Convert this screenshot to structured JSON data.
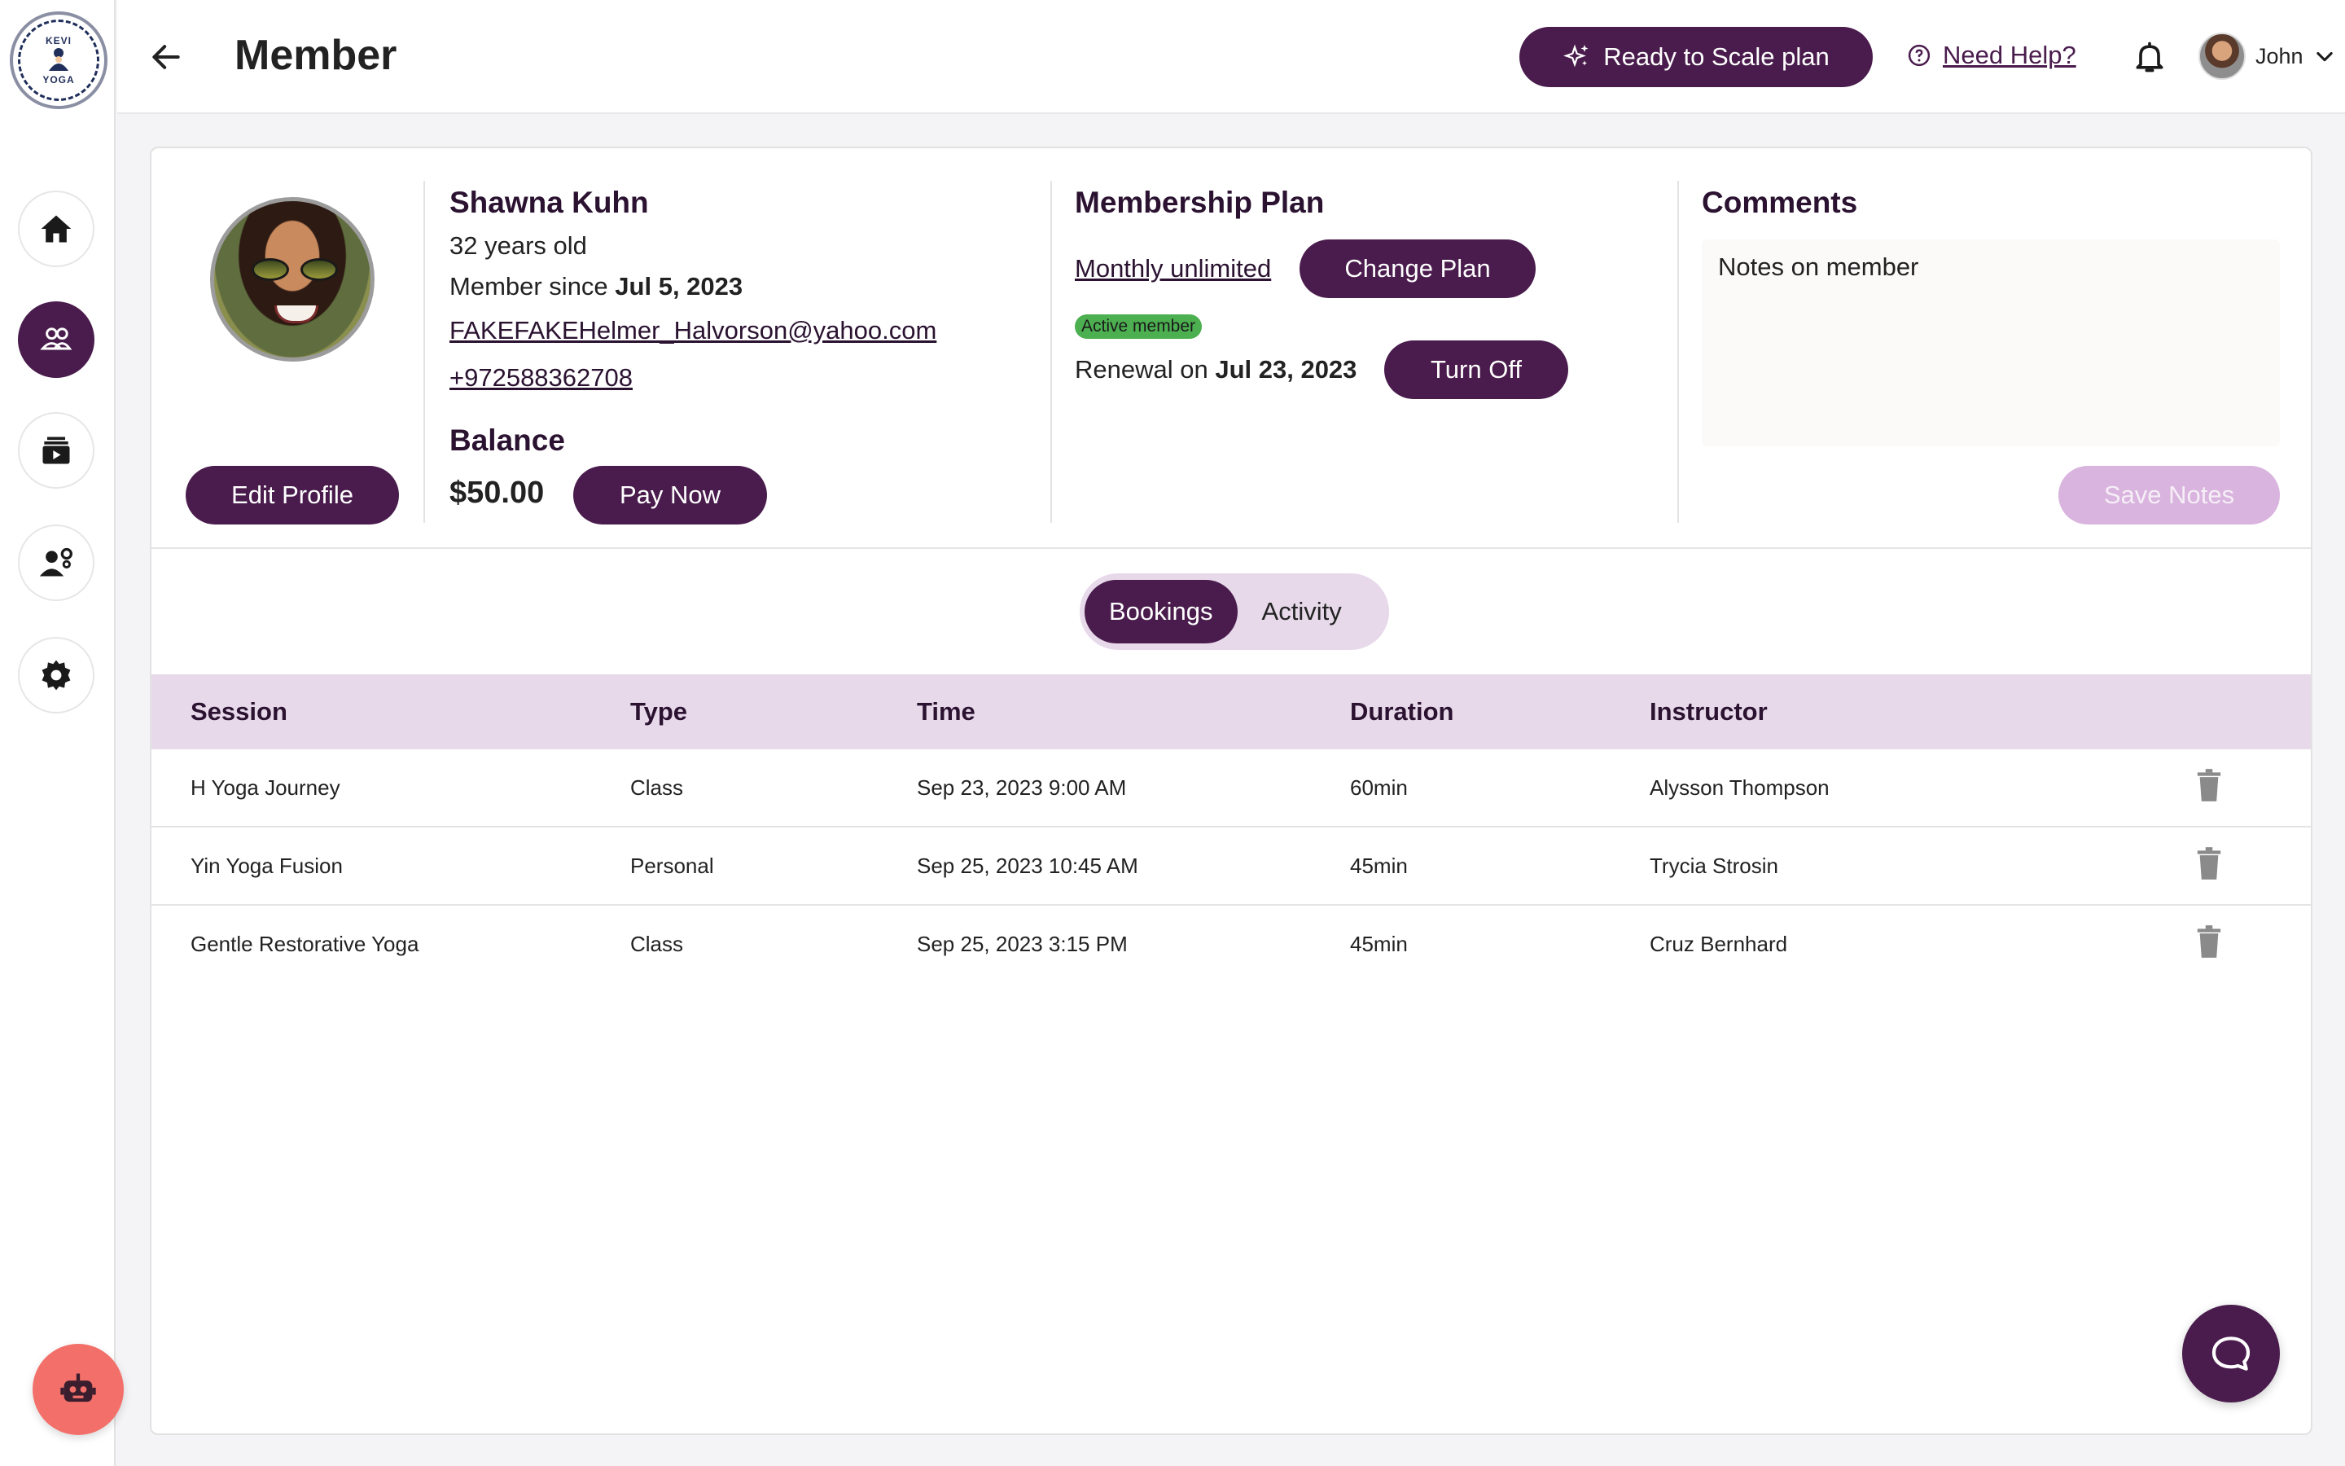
{
  "header": {
    "title": "Member",
    "scale_button": "Ready to Scale plan",
    "help_link": "Need Help?",
    "user_name": "John"
  },
  "logo": {
    "top_text": "KEVI",
    "bottom_text": "YOGA"
  },
  "sidebar": {
    "items": [
      {
        "name": "home-icon",
        "active": false
      },
      {
        "name": "members-icon",
        "active": true
      },
      {
        "name": "classes-icon",
        "active": false
      },
      {
        "name": "staff-icon",
        "active": false
      },
      {
        "name": "settings-icon",
        "active": false
      }
    ]
  },
  "member": {
    "name": "Shawna Kuhn",
    "age": "32 years old",
    "since_label": "Member since ",
    "since_date": "Jul 5, 2023",
    "email": "FAKEFAKEHelmer_Halvorson@yahoo.com",
    "phone": "+972588362708",
    "edit_button": "Edit Profile"
  },
  "balance": {
    "title": "Balance",
    "amount": "$50.00",
    "pay_button": "Pay Now"
  },
  "membership": {
    "title": "Membership Plan",
    "plan_name": "Monthly unlimited",
    "change_button": "Change Plan",
    "status_badge": "Active member",
    "renewal_label": "Renewal on ",
    "renewal_date": "Jul 23, 2023",
    "turn_off_button": "Turn Off"
  },
  "comments": {
    "title": "Comments",
    "notes_value": "Notes on member",
    "save_button": "Save Notes"
  },
  "tabs": [
    {
      "label": "Bookings",
      "active": true
    },
    {
      "label": "Activity",
      "active": false
    }
  ],
  "table": {
    "columns": [
      "Session",
      "Type",
      "Time",
      "Duration",
      "Instructor"
    ],
    "rows": [
      [
        "H Yoga Journey",
        "Class",
        "Sep 23, 2023 9:00 AM",
        "60min",
        "Alysson Thompson"
      ],
      [
        "Yin Yoga Fusion",
        "Personal",
        "Sep 25, 2023 10:45 AM",
        "45min",
        "Trycia Strosin"
      ],
      [
        "Gentle Restorative Yoga",
        "Class",
        "Sep 25, 2023 3:15 PM",
        "45min",
        "Cruz Bernhard"
      ]
    ]
  },
  "colors": {
    "brand": "#4a1c4d",
    "brand_light": "#e7d9ea",
    "active_badge": "#4caf50",
    "bot_button": "#f3706a"
  }
}
